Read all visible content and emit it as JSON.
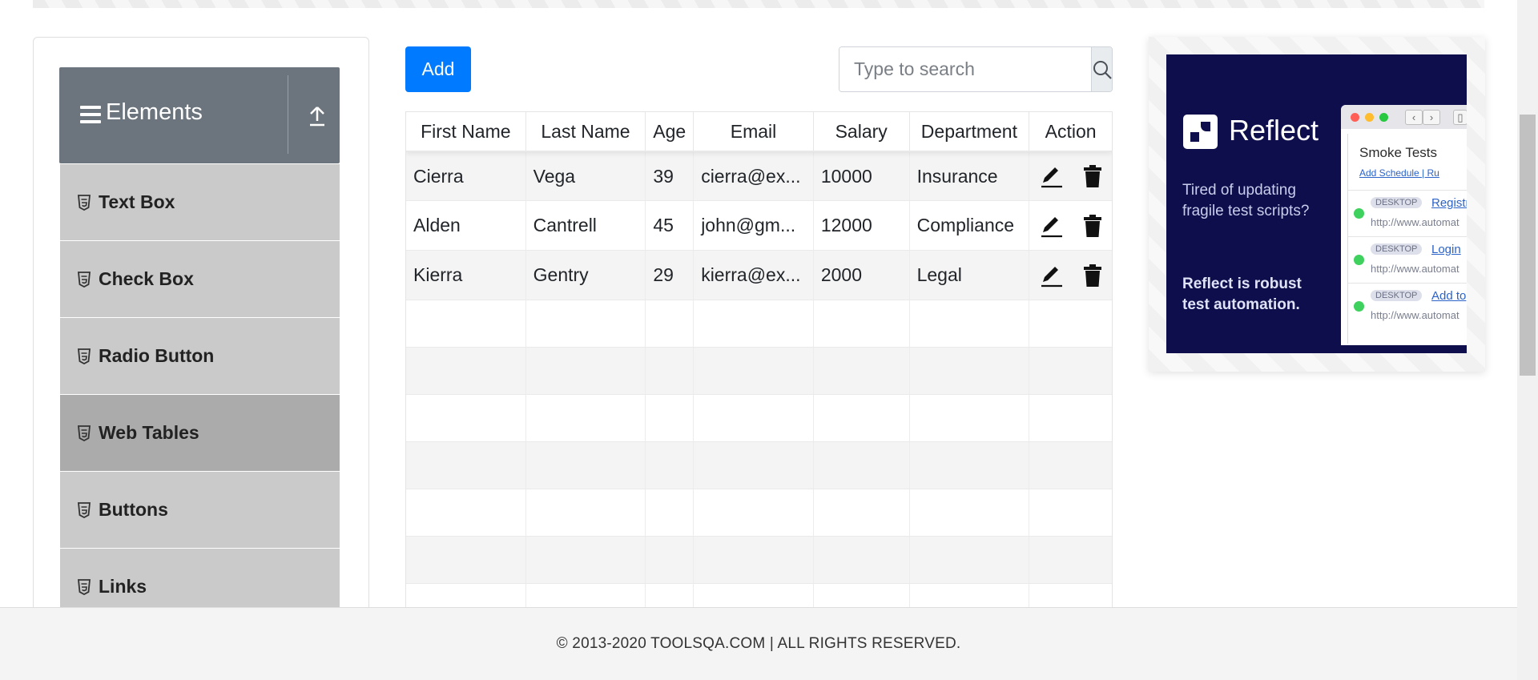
{
  "sidebar": {
    "group_title": "Elements",
    "items": [
      {
        "label": "Text Box",
        "active": false
      },
      {
        "label": "Check Box",
        "active": false
      },
      {
        "label": "Radio Button",
        "active": false
      },
      {
        "label": "Web Tables",
        "active": true
      },
      {
        "label": "Buttons",
        "active": false
      },
      {
        "label": "Links",
        "active": false
      }
    ]
  },
  "toolbar": {
    "add_label": "Add",
    "search_placeholder": "Type to search"
  },
  "table": {
    "headers": [
      "First Name",
      "Last Name",
      "Age",
      "Email",
      "Salary",
      "Department",
      "Action"
    ],
    "rows": [
      [
        "Cierra",
        "Vega",
        "39",
        "cierra@ex...",
        "10000",
        "Insurance"
      ],
      [
        "Alden",
        "Cantrell",
        "45",
        "john@gm...",
        "12000",
        "Compliance"
      ],
      [
        "Kierra",
        "Gentry",
        "29",
        "kierra@ex...",
        "2000",
        "Legal"
      ]
    ]
  },
  "ad": {
    "brand": "Reflect",
    "text1": "Tired of updating fragile test scripts?",
    "text2": "Reflect is robust test automation.",
    "browser": {
      "title": "Smoke Tests",
      "links": "Add Schedule | Ru",
      "tests": [
        {
          "tag": "DESKTOP",
          "name": "Registr",
          "url": "http://www.automat"
        },
        {
          "tag": "DESKTOP",
          "name": "Login",
          "url": "http://www.automat"
        },
        {
          "tag": "DESKTOP",
          "name": "Add to",
          "url": "http://www.automat"
        }
      ]
    }
  },
  "footer": {
    "text": "© 2013-2020 TOOLSQA.COM | ALL RIGHTS RESERVED."
  },
  "colors": {
    "primary": "#007bff",
    "group_header": "#6c757d",
    "menu_item": "#cacaca",
    "menu_item_active": "#ababab",
    "ad_background": "#0e0e4d"
  }
}
